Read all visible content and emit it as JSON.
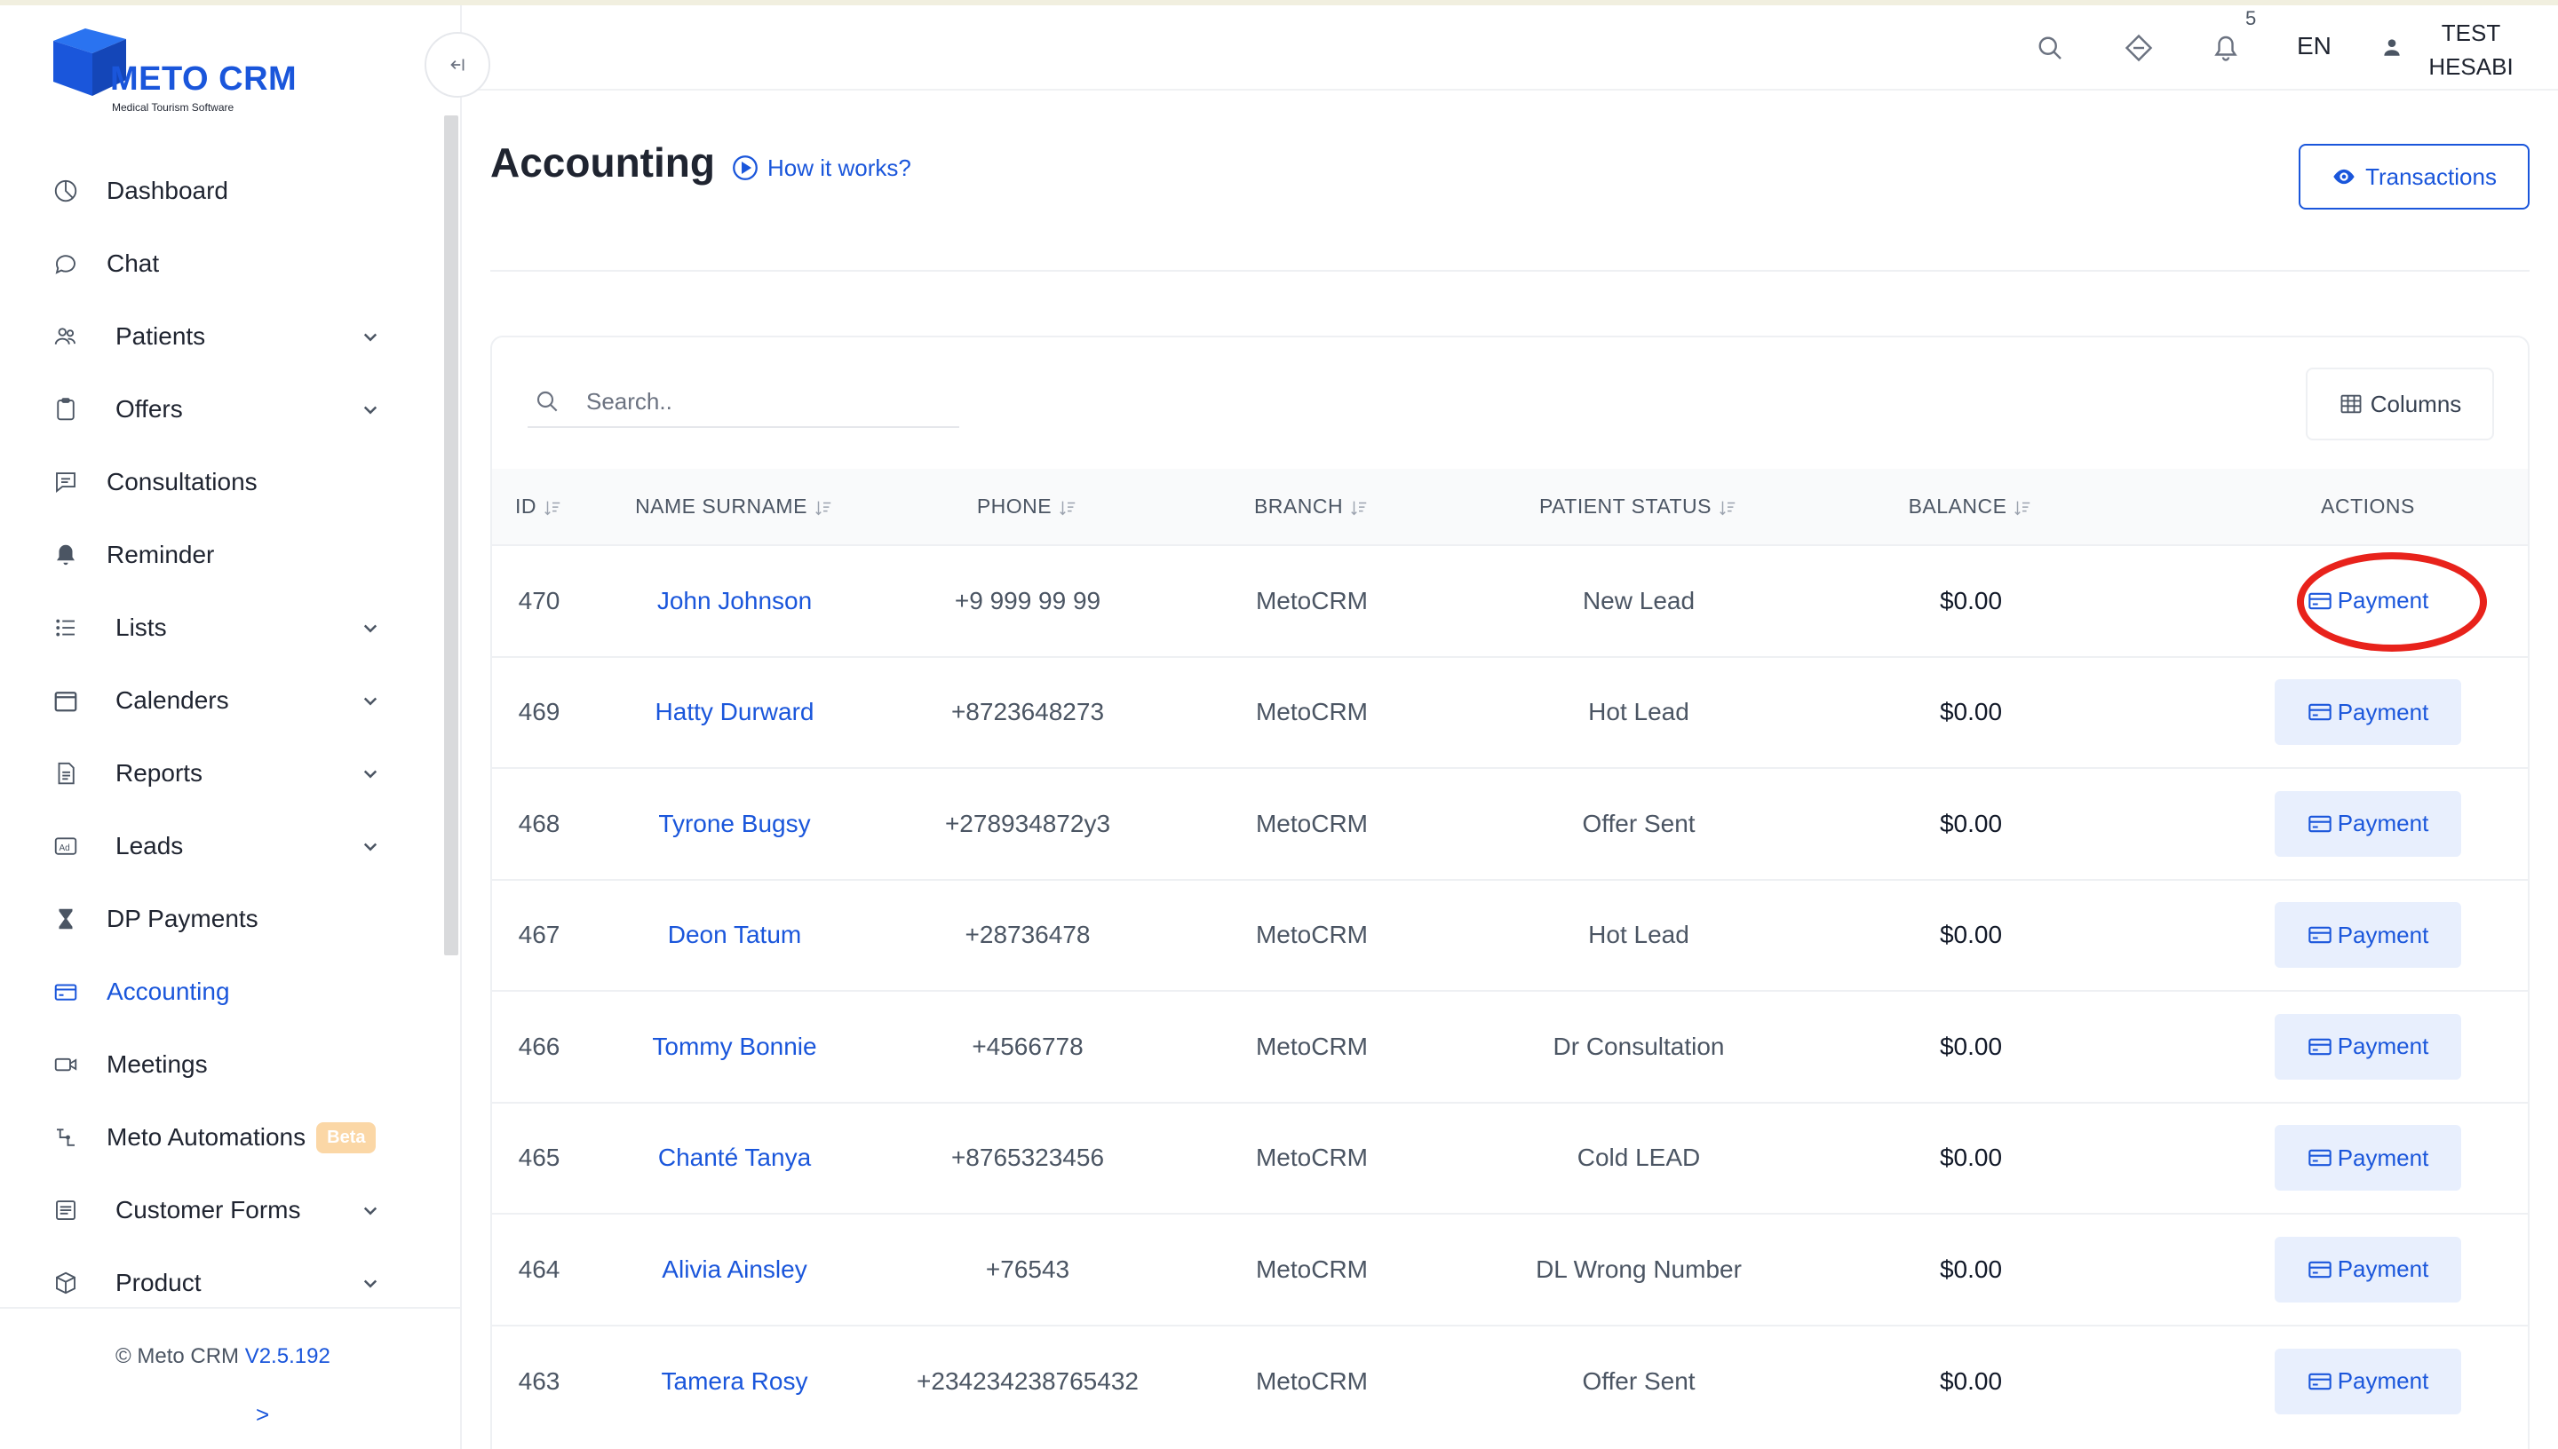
{
  "app": {
    "logo_text": "METO CRM",
    "logo_subtitle": "Medical Tourism Software",
    "brand_color": "#1a56db"
  },
  "header": {
    "notifications_count": "5",
    "language": "EN",
    "user_name": "TEST HESABI",
    "icons": [
      "search-icon",
      "diamond-icon",
      "bell-icon",
      "user-icon"
    ]
  },
  "sidebar": {
    "items": [
      {
        "label": "Dashboard",
        "icon": "dashboard-icon",
        "expandable": false
      },
      {
        "label": "Chat",
        "icon": "chat-icon",
        "expandable": false
      },
      {
        "label": "Patients",
        "icon": "users-icon",
        "expandable": true
      },
      {
        "label": "Offers",
        "icon": "clipboard-icon",
        "expandable": true
      },
      {
        "label": "Consultations",
        "icon": "message-icon",
        "expandable": false
      },
      {
        "label": "Reminder",
        "icon": "bell-icon",
        "expandable": false
      },
      {
        "label": "Lists",
        "icon": "list-icon",
        "expandable": true
      },
      {
        "label": "Calenders",
        "icon": "calendar-icon",
        "expandable": true
      },
      {
        "label": "Reports",
        "icon": "report-icon",
        "expandable": true
      },
      {
        "label": "Leads",
        "icon": "ad-icon",
        "expandable": true
      },
      {
        "label": "DP Payments",
        "icon": "hourglass-icon",
        "expandable": false
      },
      {
        "label": "Accounting",
        "icon": "credit-card-icon",
        "expandable": false,
        "active": true
      },
      {
        "label": "Meetings",
        "icon": "video-icon",
        "expandable": false
      },
      {
        "label": "Meto Automations",
        "icon": "automation-icon",
        "expandable": false,
        "badge": "Beta"
      },
      {
        "label": "Customer Forms",
        "icon": "form-icon",
        "expandable": true
      },
      {
        "label": "Product",
        "icon": "box-icon",
        "expandable": true
      }
    ],
    "footer_copyright": "© Meto CRM",
    "footer_version": "V2.5.192",
    "expand_label": ">"
  },
  "page": {
    "title": "Accounting",
    "how_it_works": "How it works?",
    "transactions_button": "Transactions"
  },
  "table": {
    "search_placeholder": "Search..",
    "columns_button": "Columns",
    "headers": [
      "ID",
      "NAME SURNAME",
      "PHONE",
      "BRANCH",
      "PATIENT STATUS",
      "BALANCE",
      "ACTIONS"
    ],
    "action_label": "Payment",
    "rows": [
      {
        "id": "470",
        "name": "John Johnson",
        "phone": "+9 999 99 99",
        "branch": "MetoCRM",
        "status": "New Lead",
        "balance": "$0.00"
      },
      {
        "id": "469",
        "name": "Hatty Durward",
        "phone": "+8723648273",
        "branch": "MetoCRM",
        "status": "Hot Lead",
        "balance": "$0.00"
      },
      {
        "id": "468",
        "name": "Tyrone Bugsy",
        "phone": "+278934872y3",
        "branch": "MetoCRM",
        "status": "Offer Sent",
        "balance": "$0.00"
      },
      {
        "id": "467",
        "name": "Deon Tatum",
        "phone": "+28736478",
        "branch": "MetoCRM",
        "status": "Hot Lead",
        "balance": "$0.00"
      },
      {
        "id": "466",
        "name": "Tommy Bonnie",
        "phone": "+4566778",
        "branch": "MetoCRM",
        "status": "Dr Consultation",
        "balance": "$0.00"
      },
      {
        "id": "465",
        "name": "Chanté Tanya",
        "phone": "+8765323456",
        "branch": "MetoCRM",
        "status": "Cold LEAD",
        "balance": "$0.00"
      },
      {
        "id": "464",
        "name": "Alivia Ainsley",
        "phone": "+76543",
        "branch": "MetoCRM",
        "status": "DL Wrong Number",
        "balance": "$0.00"
      },
      {
        "id": "463",
        "name": "Tamera Rosy",
        "phone": "+234234238765432",
        "branch": "MetoCRM",
        "status": "Offer Sent",
        "balance": "$0.00"
      }
    ]
  },
  "annotation": {
    "highlight_color": "#e8221b",
    "highlighted_row_index": 0
  }
}
